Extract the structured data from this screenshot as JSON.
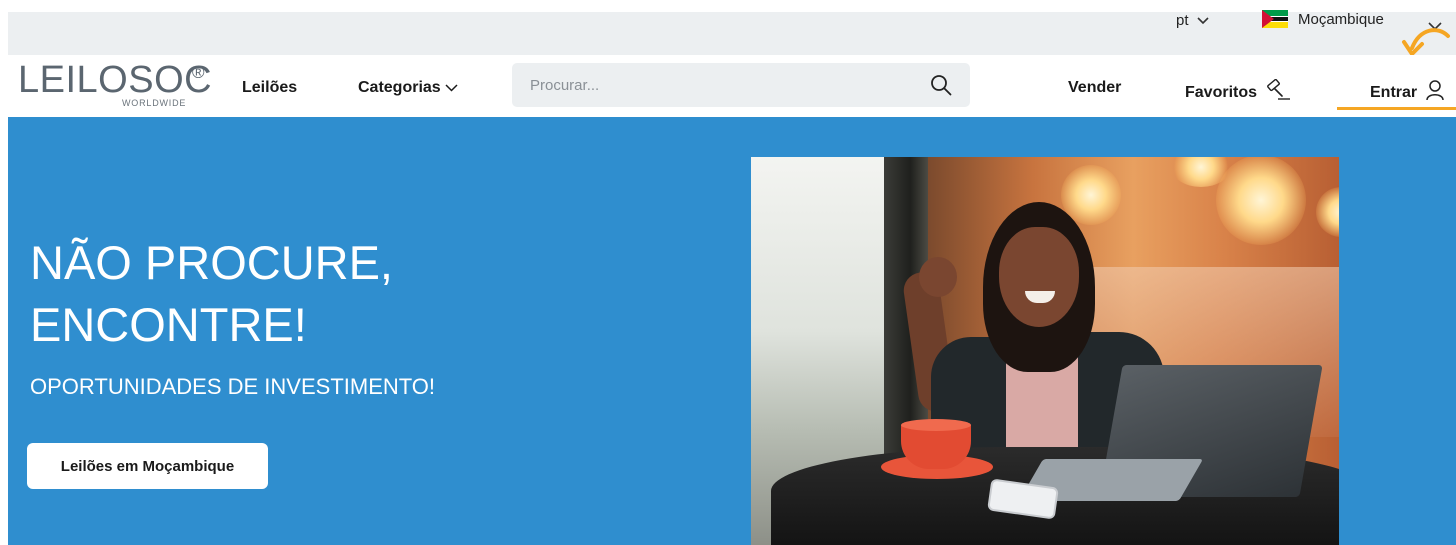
{
  "topbar": {
    "language": "pt",
    "country": "Moçambique",
    "colors": {
      "background": "#eceff1",
      "flag_green": "#009a49",
      "flag_yellow": "#fcdd09",
      "flag_red": "#d21034"
    }
  },
  "header": {
    "logo": {
      "text": "LEILOSOC",
      "registered": "®",
      "subtitle": "WORLDWIDE"
    },
    "nav": {
      "leiloes": "Leilões",
      "categorias": "Categorias",
      "vender": "Vender",
      "favoritos": "Favoritos",
      "entrar": "Entrar"
    },
    "search": {
      "placeholder": "Procurar...",
      "value": ""
    },
    "icons": {
      "search": "search-icon",
      "favoritos": "gavel-icon",
      "entrar": "user-icon",
      "categorias": "chevron-down-icon"
    },
    "colors": {
      "accent": "#f5a623"
    }
  },
  "hero": {
    "title_line1": "NÃO PROCURE,",
    "title_line2": "ENCONTRE!",
    "subtitle": "OPORTUNIDADES DE INVESTIMENTO!",
    "button_label": "Leilões em Moçambique",
    "colors": {
      "background": "#2f8ecf",
      "button_bg": "#ffffff"
    }
  }
}
